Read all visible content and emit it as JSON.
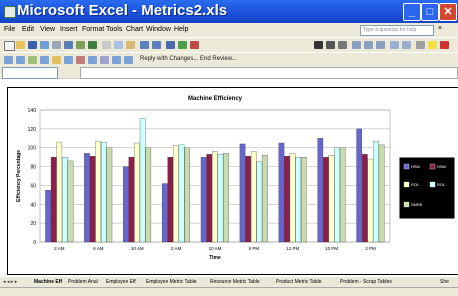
{
  "window": {
    "title": "Microsoft Excel - Metrics2.xls",
    "minimize_glyph": "_",
    "maximize_glyph": "□",
    "close_glyph": "✕"
  },
  "menubar": {
    "items": [
      "File",
      "Edit",
      "View",
      "Insert",
      "Format",
      "Tools",
      "Chart",
      "Window",
      "Help"
    ],
    "help_placeholder": "Type a question for help",
    "close_glyph": "×"
  },
  "toolbar2": {
    "review_text": "Reply with Changes...  End Review..."
  },
  "chart_data": {
    "type": "bar",
    "title": "Machine Efficiency",
    "xlabel": "Time",
    "ylabel": "Efficiency Percentage",
    "ylim": [
      0,
      140
    ],
    "yticks": [
      0,
      20,
      40,
      60,
      80,
      100,
      120,
      140
    ],
    "grid": true,
    "legend_position": "right",
    "categories": [
      "2 AM",
      "6 AM",
      "10 AM",
      "2 AM",
      "10 AM",
      "6 PM",
      "12 PM",
      "10 PM",
      "2 PM"
    ],
    "series": [
      {
        "name": "HSM",
        "color": "#6666cc",
        "values": [
          55,
          94,
          80,
          62,
          90,
          104,
          105,
          110,
          120
        ]
      },
      {
        "name": "HSM",
        "color": "#8b1e4a",
        "values": [
          90,
          91,
          90,
          90,
          93,
          91,
          91,
          90,
          93
        ]
      },
      {
        "name": "ROL",
        "color": "#ffffcc",
        "values": [
          106,
          107,
          105,
          102,
          96,
          96,
          94,
          92,
          88
        ]
      },
      {
        "name": "ROL",
        "color": "#ccffff",
        "values": [
          90,
          106,
          131,
          103,
          93,
          85,
          90,
          100,
          107
        ]
      },
      {
        "name": "",
        "color": "#c9dcb0",
        "values": [
          86,
          100,
          100,
          100,
          94,
          92,
          90,
          100,
          103
        ]
      }
    ],
    "legend_entries": [
      "HSM",
      "HSM",
      "ROL",
      "ROL",
      "SMRE"
    ]
  },
  "sheet_tabs": {
    "nav_glyphs": "◂ ◂ ▸ ▸",
    "tabs": [
      "Machine Eff",
      "Problem Anal",
      "Employee Eff",
      "Employee Metric Table",
      "Resource Metric Table",
      "Product Metric Table",
      "Problem - Scrap Tables",
      "She"
    ],
    "active_index": 0
  }
}
